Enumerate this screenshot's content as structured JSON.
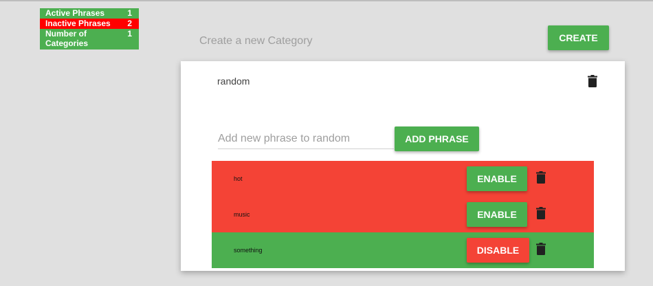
{
  "colors": {
    "green": "#4caf50",
    "red": "#f44336",
    "stat_red": "#ff0000",
    "background": "#e0e0e0"
  },
  "stats": [
    {
      "label": "Active Phrases",
      "value": "1",
      "status": "green"
    },
    {
      "label": "Inactive Phrases",
      "value": "2",
      "status": "red"
    },
    {
      "label": "Number of Categories",
      "value": "1",
      "status": "green"
    }
  ],
  "header": {
    "create_placeholder": "Create a new Category",
    "create_button": "CREATE"
  },
  "category": {
    "name": "random",
    "delete_icon": "trash-icon",
    "phrase_input_placeholder": "Add new phrase to random",
    "phrase_input_value": "",
    "add_button": "ADD PHRASE",
    "phrases": [
      {
        "text": "hot",
        "active": false,
        "button": "ENABLE"
      },
      {
        "text": "music",
        "active": false,
        "button": "ENABLE"
      },
      {
        "text": "something",
        "active": true,
        "button": "DISABLE"
      }
    ]
  }
}
